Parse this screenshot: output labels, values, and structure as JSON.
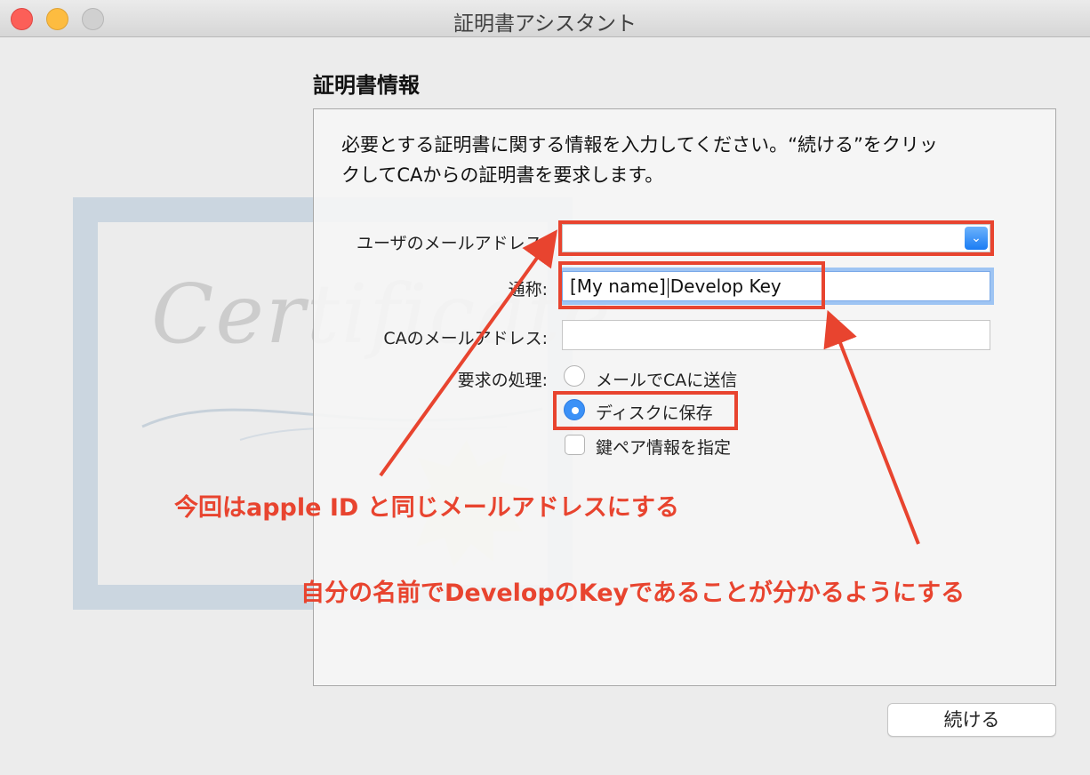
{
  "window": {
    "title": "証明書アシスタント"
  },
  "section_title": "証明書情報",
  "intro_line1": "必要とする証明書に関する情報を入力してください。“続ける”をクリッ",
  "intro_line2": "クしてCAからの証明書を要求します。",
  "background_art": {
    "word": "Certificate"
  },
  "fields": {
    "user_email": {
      "label": "ユーザのメールアドレス:",
      "value": ""
    },
    "common_name": {
      "label": "通称:",
      "value_before_caret": "[My name]",
      "value_after_caret": "Develop Key"
    },
    "ca_email": {
      "label": "CAのメールアドレス:",
      "value": ""
    },
    "request": {
      "label": "要求の処理:",
      "options": [
        {
          "label": "メールでCAに送信",
          "selected": false
        },
        {
          "label": "ディスクに保存",
          "selected": true
        }
      ],
      "checkbox": {
        "label": "鍵ペア情報を指定",
        "checked": false
      }
    }
  },
  "annotations": {
    "email_note": "今回はapple ID と同じメールアドレスにする",
    "name_note": "自分の名前でDevelopのKeyであることが分かるようにする"
  },
  "buttons": {
    "continue": "続ける"
  },
  "colors": {
    "annotation_red": "#e8442f",
    "accent_blue": "#3b91f7"
  }
}
